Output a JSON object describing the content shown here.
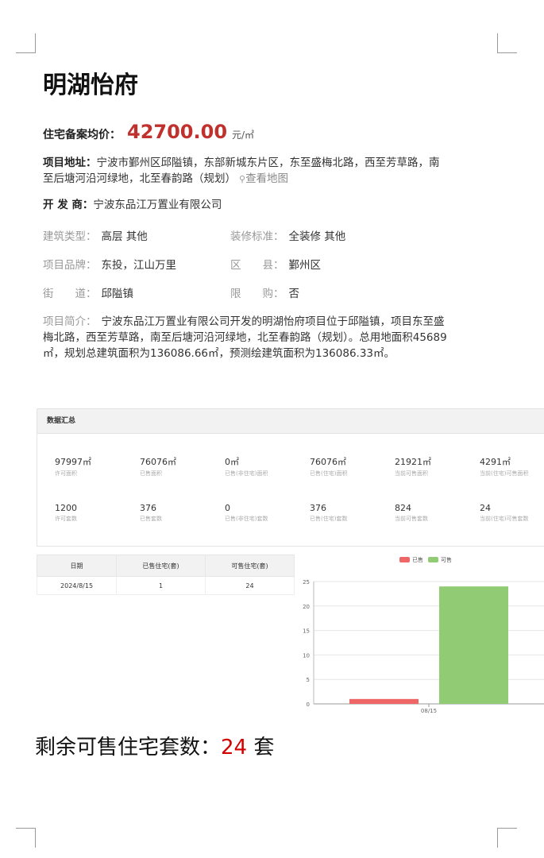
{
  "title": "明湖怡府",
  "price": {
    "label": "住宅备案均价：",
    "value": "42700.00",
    "unit": "元/㎡"
  },
  "address": {
    "label": "项目地址：",
    "text": "宁波市鄞州区邱隘镇，东部新城东片区，东至盛梅北路，西至芳草路，南至后塘河沿河绿地，北至春韵路（规划）",
    "map_link": "查看地图"
  },
  "developer": {
    "label": "开 发 商：",
    "value": "宁波东品江万置业有限公司"
  },
  "fields": [
    {
      "label": "建筑类型：",
      "value": "高层 其他"
    },
    {
      "label": "装修标准：",
      "value": "全装修 其他"
    },
    {
      "label": "项目品牌：",
      "value": "东投，江山万里"
    },
    {
      "label": "区　　县：",
      "value": "鄞州区"
    },
    {
      "label": "街　　道：",
      "value": "邱隘镇"
    },
    {
      "label": "限　　购：",
      "value": "否"
    }
  ],
  "intro": {
    "label": "项目简介：",
    "text": "宁波东品江万置业有限公司开发的明湖怡府项目位于邱隘镇，项目东至盛梅北路，西至芳草路，南至后塘河沿河绿地，北至春韵路（规划）。总用地面积45689㎡，规划总建筑面积为136086.66㎡，预测绘建筑面积为136086.33㎡。"
  },
  "summary": {
    "title": "数据汇总",
    "row1": [
      {
        "value": "97997㎡",
        "label": "许可面积"
      },
      {
        "value": "76076㎡",
        "label": "已售面积"
      },
      {
        "value": "0㎡",
        "label": "已售(非住宅)面积"
      },
      {
        "value": "76076㎡",
        "label": "已售(住宅)面积"
      },
      {
        "value": "21921㎡",
        "label": "当前可售面积"
      },
      {
        "value": "4291㎡",
        "label": "当前(住宅)可售面积"
      }
    ],
    "row2": [
      {
        "value": "1200",
        "label": "许可套数"
      },
      {
        "value": "376",
        "label": "已售套数"
      },
      {
        "value": "0",
        "label": "已售(非住宅)套数"
      },
      {
        "value": "376",
        "label": "已售(住宅)套数"
      },
      {
        "value": "824",
        "label": "当前可售套数"
      },
      {
        "value": "24",
        "label": "当前(住宅)可售套数"
      }
    ]
  },
  "table": {
    "headers": [
      "日期",
      "已售住宅(套)",
      "可售住宅(套)"
    ],
    "rows": [
      [
        "2024/8/15",
        "1",
        "24"
      ]
    ]
  },
  "chart_data": {
    "type": "bar",
    "categories": [
      "08/15"
    ],
    "series": [
      {
        "name": "已售",
        "values": [
          1
        ],
        "color": "#ee6666"
      },
      {
        "name": "可售",
        "values": [
          24
        ],
        "color": "#91cc75"
      }
    ],
    "ylim": [
      0,
      25
    ],
    "yticks": [
      0,
      5,
      10,
      15,
      20,
      25
    ],
    "grid": true,
    "legend": "top-center"
  },
  "remaining": {
    "prefix": "剩余可售住宅套数：",
    "number": "24",
    "suffix": " 套"
  }
}
